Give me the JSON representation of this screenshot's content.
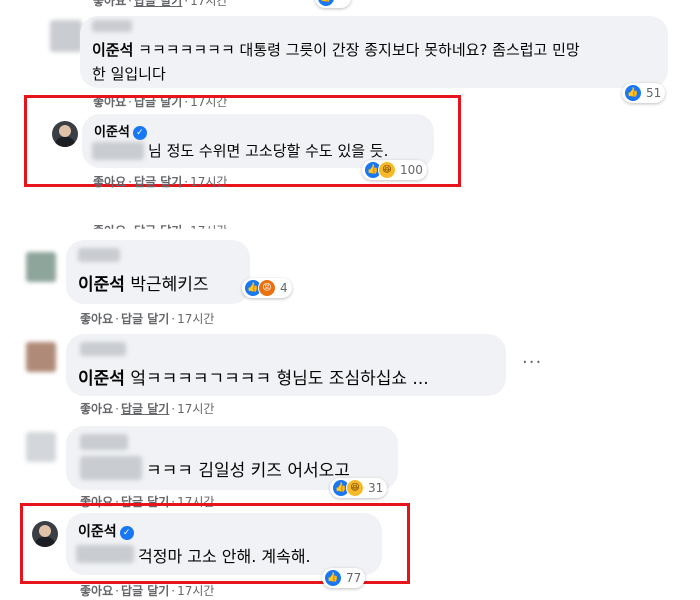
{
  "actions": {
    "like": "좋아요",
    "reply": "답글 달기",
    "time": "17시간"
  },
  "comments": [
    {
      "text": "이준석 ㅋㅋㅋㅋㅋㅋㅋ 대통령 그릇이 간장 종지보다 못하네요? 좀스럽고 민망한 일입니다",
      "name_prefix": "이준석",
      "text_rest": " ㅋㅋㅋㅋㅋㅋㅋ 대통령 그릇이 간장 종지보다 못하네요? 좀스럽고 민망",
      "text_line2": "한 일입니다",
      "reactions": "51"
    },
    {
      "author": "이준석",
      "text": "님 정도 수위면 고소당할 수도 있을 듯.",
      "reactions": "100"
    },
    {
      "name_prefix": "이준석",
      "text_rest": " 박근혜키즈",
      "reactions": "4"
    },
    {
      "name_prefix": "이준석",
      "text_rest": " 엌ㅋㅋㅋㅋㄱㅋㅋㅋ 형님도 조심하십쇼 ...",
      "more": "···"
    },
    {
      "text": "ㅋㅋㅋ 김일성 키즈 어서오고",
      "reactions": "31"
    },
    {
      "author": "이준석",
      "text": "걱정마 고소 안해. 계속해.",
      "reactions": "77"
    }
  ]
}
